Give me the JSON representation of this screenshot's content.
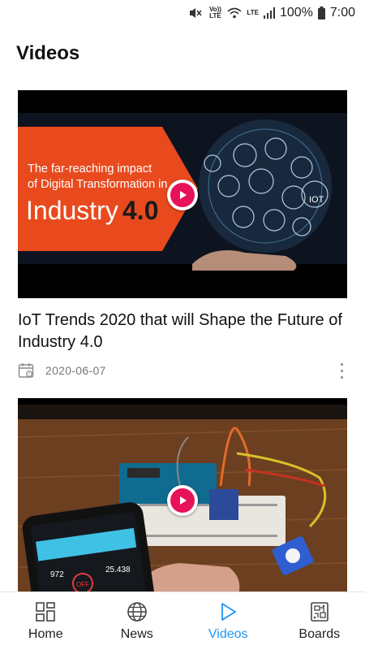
{
  "status_bar": {
    "volte_label": "Vo)) LTE",
    "lte_label": "LTE",
    "battery": "100%",
    "time": "7:00"
  },
  "header": {
    "title": "Videos"
  },
  "videos": [
    {
      "thumbnail_text": {
        "line1": "The far-reaching impact",
        "line2": "of Digital Transformation in",
        "line3": "Industry",
        "line3_accent": "4.0",
        "badge": "IOT"
      },
      "title": "IoT Trends 2020 that will Shape the Future of Industry 4.0",
      "date": "2020-06-07"
    },
    {
      "thumbnail_text": {
        "phone_value_left": "972",
        "phone_value_right": "25.438",
        "phone_button": "OFF"
      },
      "title": "",
      "date": ""
    }
  ],
  "nav": {
    "items": [
      {
        "label": "Home",
        "icon": "home-grid-icon"
      },
      {
        "label": "News",
        "icon": "globe-icon"
      },
      {
        "label": "Videos",
        "icon": "play-outline-icon"
      },
      {
        "label": "Boards",
        "icon": "circuit-board-icon"
      }
    ],
    "active": "Videos",
    "active_color": "#2196f3"
  },
  "colors": {
    "play_accent": "#e8115b",
    "thumb_orange": "#e84a1e"
  }
}
